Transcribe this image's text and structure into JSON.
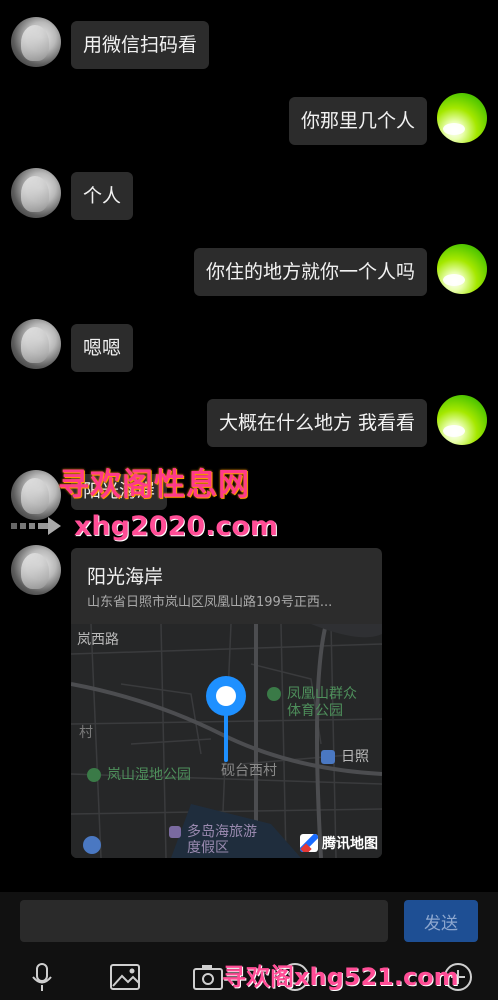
{
  "messages": [
    {
      "side": "left",
      "text": "用微信扫码看"
    },
    {
      "side": "right",
      "text": "你那里几个人"
    },
    {
      "side": "left",
      "text": "个人"
    },
    {
      "side": "right",
      "text": "你住的地方就你一个人吗"
    },
    {
      "side": "left",
      "text": "嗯嗯"
    },
    {
      "side": "right",
      "text": "大概在什么地方 我看看"
    },
    {
      "side": "left",
      "text": "阳光海岸"
    }
  ],
  "watermark": {
    "top": "寻欢阁性息网",
    "mid": "xhg2020.com",
    "bottom": "寻欢阁xhg521.com"
  },
  "location": {
    "title": "阳光海岸",
    "address": "山东省日照市岚山区凤凰山路199号正西...",
    "map_labels": {
      "road1": "岚西路",
      "park1": "凤凰山群众",
      "park1b": "体育公园",
      "village": "村",
      "station": "日照",
      "wetland": "岚山湿地公园",
      "village2": "砚台西村",
      "resort": "多岛海旅游",
      "resortb": "度假区"
    },
    "brand": "腾讯地图"
  },
  "composer": {
    "send_label": "发送"
  },
  "icons": [
    "mic-icon",
    "image-icon",
    "camera-icon",
    "emoji-icon",
    "plus-icon"
  ]
}
